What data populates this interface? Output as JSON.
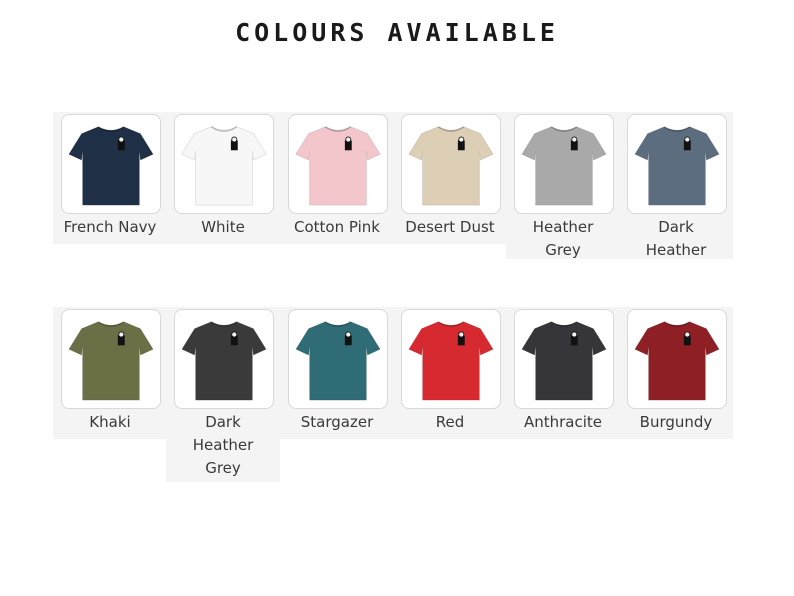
{
  "title": "COLOURS AVAILABLE",
  "colours": [
    {
      "name": "French Navy",
      "hex": "#1f2f45"
    },
    {
      "name": "White",
      "hex": "#f7f7f7"
    },
    {
      "name": "Cotton Pink",
      "hex": "#f3c6cc"
    },
    {
      "name": "Desert Dust",
      "hex": "#ddcfb6"
    },
    {
      "name": "Heather Grey",
      "hex": "#a9a9a9"
    },
    {
      "name": "Dark Heather",
      "hex": "#5d6d80"
    },
    {
      "name": "Khaki",
      "hex": "#6b6f45"
    },
    {
      "name": "Dark Heather Grey",
      "hex": "#3a3a3a"
    },
    {
      "name": "Stargazer",
      "hex": "#2f6c75"
    },
    {
      "name": "Red",
      "hex": "#d72930"
    },
    {
      "name": "Anthracite",
      "hex": "#35353a"
    },
    {
      "name": "Burgundy",
      "hex": "#8e2025"
    }
  ]
}
